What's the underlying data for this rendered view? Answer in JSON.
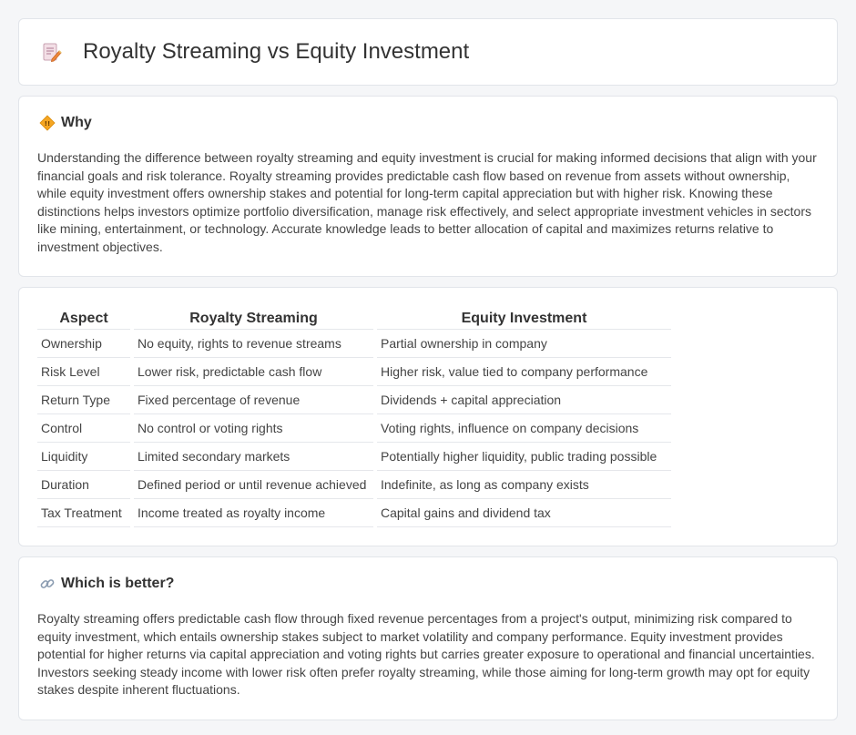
{
  "header": {
    "title": "Royalty Streaming vs Equity Investment",
    "icon": "document-pen-icon"
  },
  "why": {
    "heading": "Why",
    "icon": "diamond-warning-icon",
    "text": "Understanding the difference between royalty streaming and equity investment is crucial for making informed decisions that align with your financial goals and risk tolerance. Royalty streaming provides predictable cash flow based on revenue from assets without ownership, while equity investment offers ownership stakes and potential for long-term capital appreciation but with higher risk. Knowing these distinctions helps investors optimize portfolio diversification, manage risk effectively, and select appropriate investment vehicles in sectors like mining, entertainment, or technology. Accurate knowledge leads to better allocation of capital and maximizes returns relative to investment objectives."
  },
  "table": {
    "headers": [
      "Aspect",
      "Royalty Streaming",
      "Equity Investment"
    ],
    "rows": [
      [
        "Ownership",
        "No equity, rights to revenue streams",
        "Partial ownership in company"
      ],
      [
        "Risk Level",
        "Lower risk, predictable cash flow",
        "Higher risk, value tied to company performance"
      ],
      [
        "Return Type",
        "Fixed percentage of revenue",
        "Dividends + capital appreciation"
      ],
      [
        "Control",
        "No control or voting rights",
        "Voting rights, influence on company decisions"
      ],
      [
        "Liquidity",
        "Limited secondary markets",
        "Potentially higher liquidity, public trading possible"
      ],
      [
        "Duration",
        "Defined period or until revenue achieved",
        "Indefinite, as long as company exists"
      ],
      [
        "Tax Treatment",
        "Income treated as royalty income",
        "Capital gains and dividend tax"
      ]
    ]
  },
  "better": {
    "heading": "Which is better?",
    "icon": "link-icon",
    "text": "Royalty streaming offers predictable cash flow through fixed revenue percentages from a project's output, minimizing risk compared to equity investment, which entails ownership stakes subject to market volatility and company performance. Equity investment provides potential for higher returns via capital appreciation and voting rights but carries greater exposure to operational and financial uncertainties. Investors seeking steady income with lower risk often prefer royalty streaming, while those aiming for long-term growth may opt for equity stakes despite inherent fluctuations."
  }
}
